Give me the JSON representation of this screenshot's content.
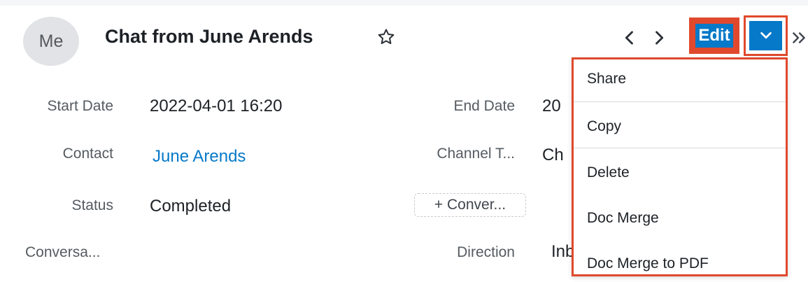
{
  "header": {
    "avatar_text": "Me",
    "title": "Chat from June Arends",
    "edit_label": "Edit"
  },
  "icons": {
    "favorite": "star-outline-icon",
    "prev": "chevron-left-icon",
    "next": "chevron-right-icon",
    "actions": "chevron-down-icon",
    "more": "double-chevron-right-icon"
  },
  "fields": {
    "start_date": {
      "label": "Start Date",
      "value": "2022-04-01 16:20"
    },
    "end_date": {
      "label": "End Date",
      "value": "20"
    },
    "contact": {
      "label": "Contact",
      "value": "June Arends"
    },
    "channel_type": {
      "label": "Channel T...",
      "value": "Ch"
    },
    "status": {
      "label": "Status",
      "value": "Completed"
    },
    "conversation": {
      "label": "Conversa..."
    },
    "direction": {
      "label": "Direction",
      "value": "Inb"
    },
    "convert_button": "+ Conver..."
  },
  "menu": {
    "items": [
      "Share",
      "Copy",
      "Delete",
      "Doc Merge",
      "Doc Merge to PDF"
    ]
  },
  "colors": {
    "primary": "#0679c8",
    "highlight": "#e0492d",
    "link": "#0679c8"
  }
}
